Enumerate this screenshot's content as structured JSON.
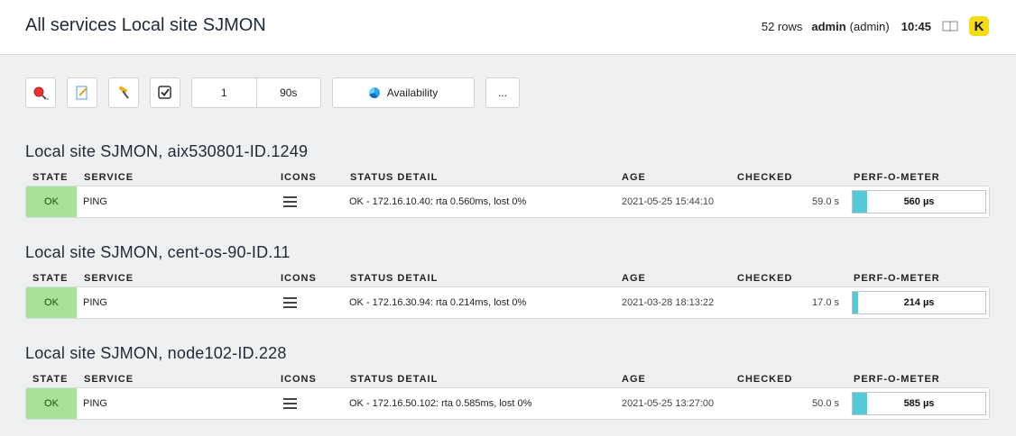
{
  "header": {
    "title": "All services Local site SJMON",
    "rows": "52 rows",
    "user": "admin",
    "role": "(admin)",
    "time": "10:45",
    "logo_letter": "K"
  },
  "toolbar": {
    "buttons": [
      {
        "name": "search-icon"
      },
      {
        "name": "edit-icon"
      },
      {
        "name": "commands-icon"
      },
      {
        "name": "checkbox-icon"
      }
    ],
    "refresh_count": "1",
    "refresh_interval": "90s",
    "availability_label": "Availability",
    "more_label": "..."
  },
  "columns": {
    "state": "STATE",
    "service": "SERVICE",
    "icons": "ICONS",
    "status_detail": "STATUS DETAIL",
    "age": "AGE",
    "checked": "CHECKED",
    "perf": "PERF-O-METER"
  },
  "groups": [
    {
      "title": "Local site SJMON, aix530801-ID.1249",
      "state": "OK",
      "service": "PING",
      "status_detail": "OK - 172.16.10.40: rta 0.560ms, lost 0%",
      "age": "2021-05-25 15:44:10",
      "checked": "59.0 s",
      "perf_label": "560 µs",
      "perf_fraction": 0.11
    },
    {
      "title": "Local site SJMON, cent-os-90-ID.11",
      "state": "OK",
      "service": "PING",
      "status_detail": "OK - 172.16.30.94: rta 0.214ms, lost 0%",
      "age": "2021-03-28 18:13:22",
      "checked": "17.0 s",
      "perf_label": "214 µs",
      "perf_fraction": 0.04
    },
    {
      "title": "Local site SJMON, node102-ID.228",
      "state": "OK",
      "service": "PING",
      "status_detail": "OK - 172.16.50.102: rta 0.585ms, lost 0%",
      "age": "2021-05-25 13:27:00",
      "checked": "50.0 s",
      "perf_label": "585 µs",
      "perf_fraction": 0.11
    }
  ],
  "colors": {
    "state_ok": "#a8e296",
    "perf_fill": "#56c9d8",
    "logo": "#f5dc15"
  }
}
